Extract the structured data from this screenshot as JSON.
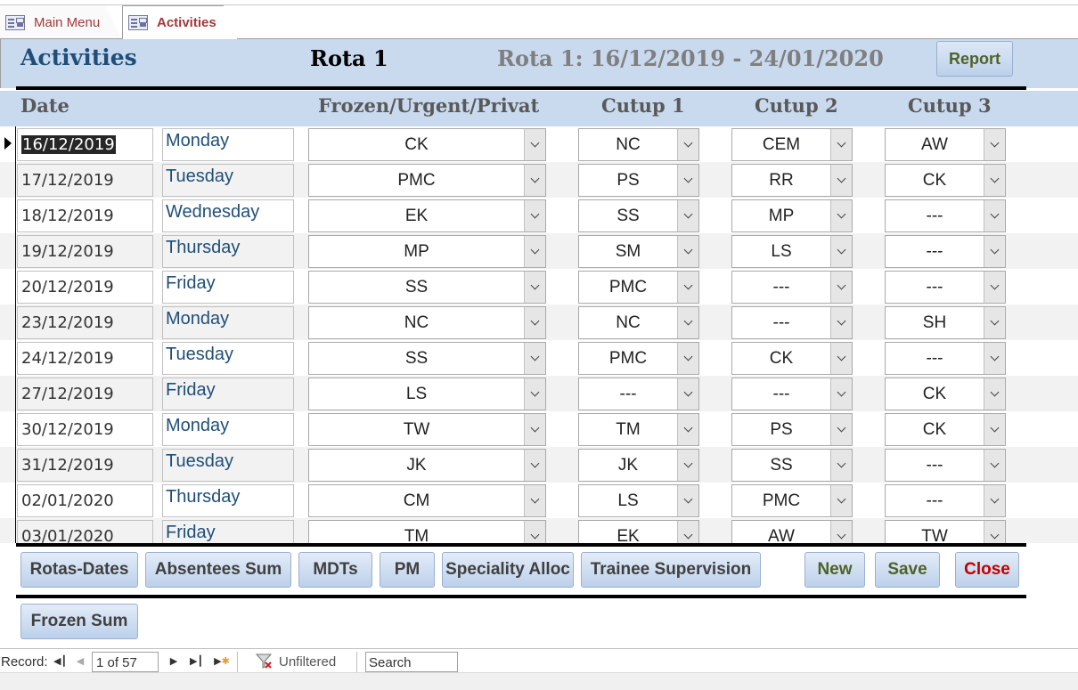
{
  "tabs": [
    {
      "label": "Main Menu",
      "icon": "form-icon"
    },
    {
      "label": "Activities",
      "icon": "form-icon"
    }
  ],
  "header": {
    "title": "Activities",
    "rota_label": "Rota 1",
    "rota_range": "Rota 1: 16/12/2019 - 24/01/2020",
    "report_button": "Report"
  },
  "columns": {
    "date": "Date",
    "frozen": "Frozen/Urgent/Privat",
    "cutup1": "Cutup 1",
    "cutup2": "Cutup 2",
    "cutup3": "Cutup 3"
  },
  "rows": [
    {
      "date": "16/12/2019",
      "day": "Monday",
      "frozen": "CK",
      "cutup1": "NC",
      "cutup2": "CEM",
      "cutup3": "AW"
    },
    {
      "date": "17/12/2019",
      "day": "Tuesday",
      "frozen": "PMC",
      "cutup1": "PS",
      "cutup2": "RR",
      "cutup3": "CK"
    },
    {
      "date": "18/12/2019",
      "day": "Wednesday",
      "frozen": "EK",
      "cutup1": "SS",
      "cutup2": "MP",
      "cutup3": "---"
    },
    {
      "date": "19/12/2019",
      "day": "Thursday",
      "frozen": "MP",
      "cutup1": "SM",
      "cutup2": "LS",
      "cutup3": "---"
    },
    {
      "date": "20/12/2019",
      "day": "Friday",
      "frozen": "SS",
      "cutup1": "PMC",
      "cutup2": "---",
      "cutup3": "---"
    },
    {
      "date": "23/12/2019",
      "day": "Monday",
      "frozen": "NC",
      "cutup1": "NC",
      "cutup2": "---",
      "cutup3": "SH"
    },
    {
      "date": "24/12/2019",
      "day": "Tuesday",
      "frozen": "SS",
      "cutup1": "PMC",
      "cutup2": "CK",
      "cutup3": "---"
    },
    {
      "date": "27/12/2019",
      "day": "Friday",
      "frozen": "LS",
      "cutup1": "---",
      "cutup2": "---",
      "cutup3": "CK"
    },
    {
      "date": "30/12/2019",
      "day": "Monday",
      "frozen": "TW",
      "cutup1": "TM",
      "cutup2": "PS",
      "cutup3": "CK"
    },
    {
      "date": "31/12/2019",
      "day": "Tuesday",
      "frozen": "JK",
      "cutup1": "JK",
      "cutup2": "SS",
      "cutup3": "---"
    },
    {
      "date": "02/01/2020",
      "day": "Thursday",
      "frozen": "CM",
      "cutup1": "LS",
      "cutup2": "PMC",
      "cutup3": "---"
    },
    {
      "date": "03/01/2020",
      "day": "Friday",
      "frozen": "TM",
      "cutup1": "EK",
      "cutup2": "AW",
      "cutup3": "TW"
    }
  ],
  "buttons": {
    "rotas_dates": "Rotas-Dates",
    "absentees_sum": "Absentees Sum",
    "mdts": "MDTs",
    "pm": "PM",
    "speciality_alloc": "Speciality Alloc",
    "trainee_supervision": "Trainee Supervision",
    "new": "New",
    "save": "Save",
    "close": "Close",
    "frozen_sum": "Frozen Sum"
  },
  "navbar": {
    "record_label": "Record:",
    "record_position": "1 of 57",
    "filter_status": "Unfiltered",
    "search_placeholder": "Search"
  },
  "colors": {
    "header_band": "#c9d9ee",
    "title_blue": "#1e4e79",
    "tab_text": "#a4373a",
    "button_green": "#4f6228",
    "button_red": "#c00000"
  }
}
